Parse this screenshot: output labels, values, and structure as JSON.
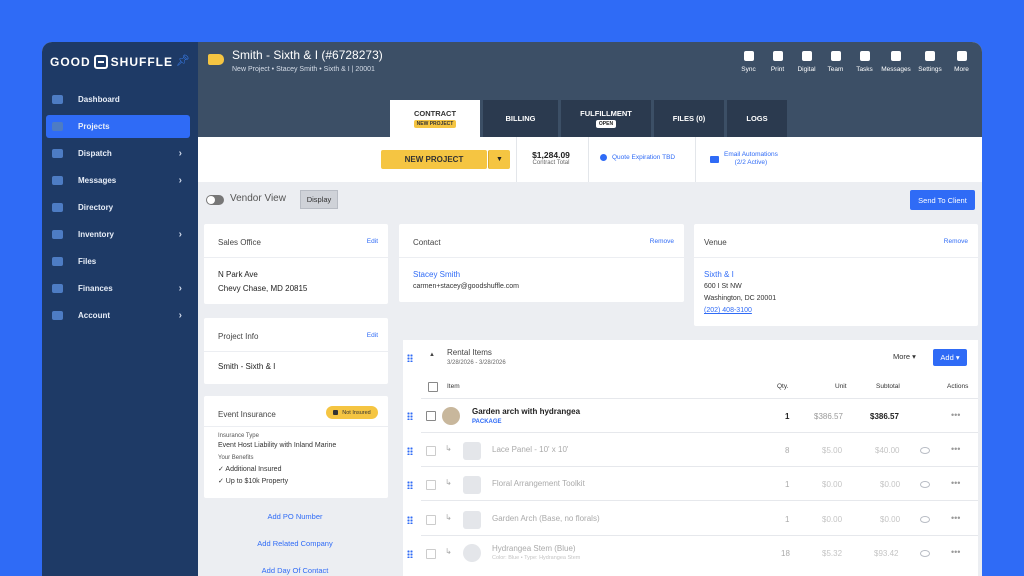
{
  "app": {
    "logo_left": "GOOD",
    "logo_right": "SHUFFLE"
  },
  "sidebar": {
    "items": [
      {
        "label": "Dashboard",
        "chevron": false,
        "active": false
      },
      {
        "label": "Projects",
        "chevron": false,
        "active": true
      },
      {
        "label": "Dispatch",
        "chevron": true,
        "active": false
      },
      {
        "label": "Messages",
        "chevron": true,
        "active": false
      },
      {
        "label": "Directory",
        "chevron": false,
        "active": false
      },
      {
        "label": "Inventory",
        "chevron": true,
        "active": false
      },
      {
        "label": "Files",
        "chevron": false,
        "active": false
      },
      {
        "label": "Finances",
        "chevron": true,
        "active": false
      },
      {
        "label": "Account",
        "chevron": true,
        "active": false
      }
    ]
  },
  "header": {
    "title": "Smith - Sixth & I (#6728273)",
    "breadcrumb": "New Project • Stacey Smith • Sixth & I | 20001",
    "tools": [
      "Sync",
      "Print",
      "Digital",
      "Team",
      "Tasks",
      "Messages",
      "Settings",
      "More"
    ]
  },
  "tabs": [
    {
      "label": "CONTRACT",
      "badge": "NEW PROJECT"
    },
    {
      "label": "BILLING",
      "badge": ""
    },
    {
      "label": "FULFILLMENT",
      "badge": "OPEN"
    },
    {
      "label": "FILES (0)",
      "badge": ""
    },
    {
      "label": "LOGS",
      "badge": ""
    }
  ],
  "actionbar": {
    "new_project": "NEW PROJECT",
    "total_amount": "$1,284.09",
    "total_label": "Contract Total",
    "quote": "Quote Expiration TBD",
    "email_line1": "Email Automations",
    "email_line2": "(2/2 Active)"
  },
  "view": {
    "vendor_view": "Vendor View",
    "display": "Display",
    "send": "Send To Client"
  },
  "sales_office": {
    "header": "Sales Office",
    "edit": "Edit",
    "line1": "N Park Ave",
    "line2": "Chevy Chase, MD 20815"
  },
  "project_info": {
    "header": "Project Info",
    "edit": "Edit",
    "name": "Smith - Sixth & I"
  },
  "insurance": {
    "header": "Event Insurance",
    "badge": "Not Insured",
    "type_label": "Insurance Type",
    "type_value": "Event Host Liability with Inland Marine",
    "benefits_label": "Your Benefits",
    "benefit1": "✓ Additional Insured",
    "benefit2": "✓ Up to $10k Property"
  },
  "side_links": [
    "Add PO Number",
    "Add Related Company",
    "Add Day Of Contact"
  ],
  "contact": {
    "header": "Contact",
    "remove": "Remove",
    "name": "Stacey Smith",
    "email": "carmen+stacey@goodshuffle.com"
  },
  "venue": {
    "header": "Venue",
    "remove": "Remove",
    "name": "Sixth & I",
    "street": "600 I St NW",
    "city": "Washington, DC 20001",
    "phone": "(202) 408-3100"
  },
  "rental": {
    "title": "Rental Items",
    "dates": "3/28/2026 - 3/28/2026",
    "more": "More ▾",
    "add": "Add ▾",
    "columns": {
      "item": "Item",
      "qty": "Qty.",
      "unit": "Unit",
      "subtotal": "Subtotal",
      "actions": "Actions"
    },
    "rows": [
      {
        "name": "Garden arch with hydrangea",
        "sub": "PACKAGE",
        "qty": "1",
        "unit": "$386.57",
        "subtotal": "$386.57"
      },
      {
        "name": "Lace Panel - 10' x 10'",
        "sub": "",
        "qty": "8",
        "unit": "$5.00",
        "subtotal": "$40.00"
      },
      {
        "name": "Floral Arrangement Toolkit",
        "sub": "",
        "qty": "1",
        "unit": "$0.00",
        "subtotal": "$0.00"
      },
      {
        "name": "Garden Arch (Base, no florals)",
        "sub": "",
        "qty": "1",
        "unit": "$0.00",
        "subtotal": "$0.00"
      },
      {
        "name": "Hydrangea Stem (Blue)",
        "sub": "Color: Blue • Type: Hydrangea Stem",
        "qty": "18",
        "unit": "$5.32",
        "subtotal": "$93.42"
      }
    ]
  },
  "colors": {
    "accent": "#2f6bf6",
    "sidebar": "#1e3a66",
    "header": "#3c4f66",
    "highlight": "#f5c542"
  }
}
